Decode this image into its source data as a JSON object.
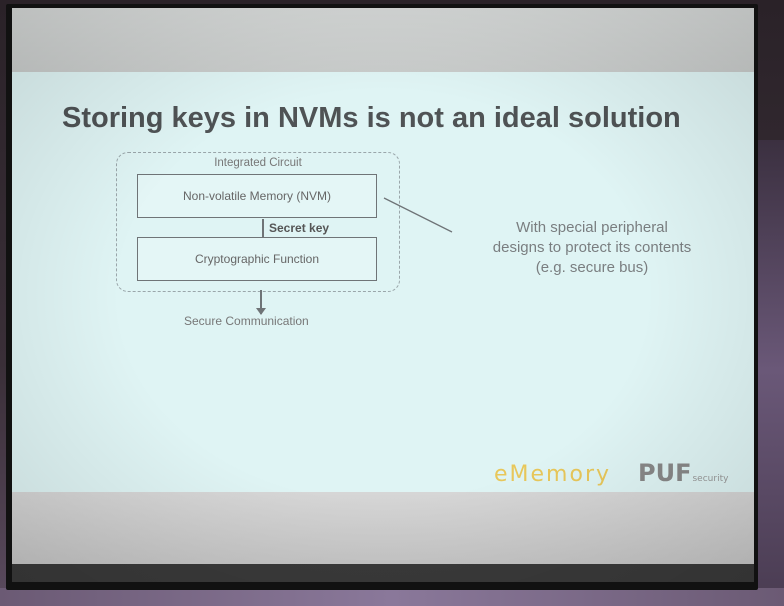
{
  "slide": {
    "title": "Storing keys in NVMs is not an ideal solution",
    "diagram": {
      "container_label": "Integrated Circuit",
      "top_block": "Non-volatile Memory (NVM)",
      "link_label": "Secret key",
      "bottom_block": "Cryptographic Function",
      "output_label": "Secure Communication"
    },
    "callout_lines": [
      "With special peripheral",
      "designs to protect its contents",
      "(e.g. secure bus)"
    ],
    "logos": {
      "brand1": "eMemory",
      "brand2_main": "PUF",
      "brand2_sub": "security"
    }
  },
  "colors": {
    "slide_bg": "#dff4f4",
    "title": "#4f5355",
    "logo_brand1": "#e8c75a",
    "logo_brand2": "#888888"
  }
}
